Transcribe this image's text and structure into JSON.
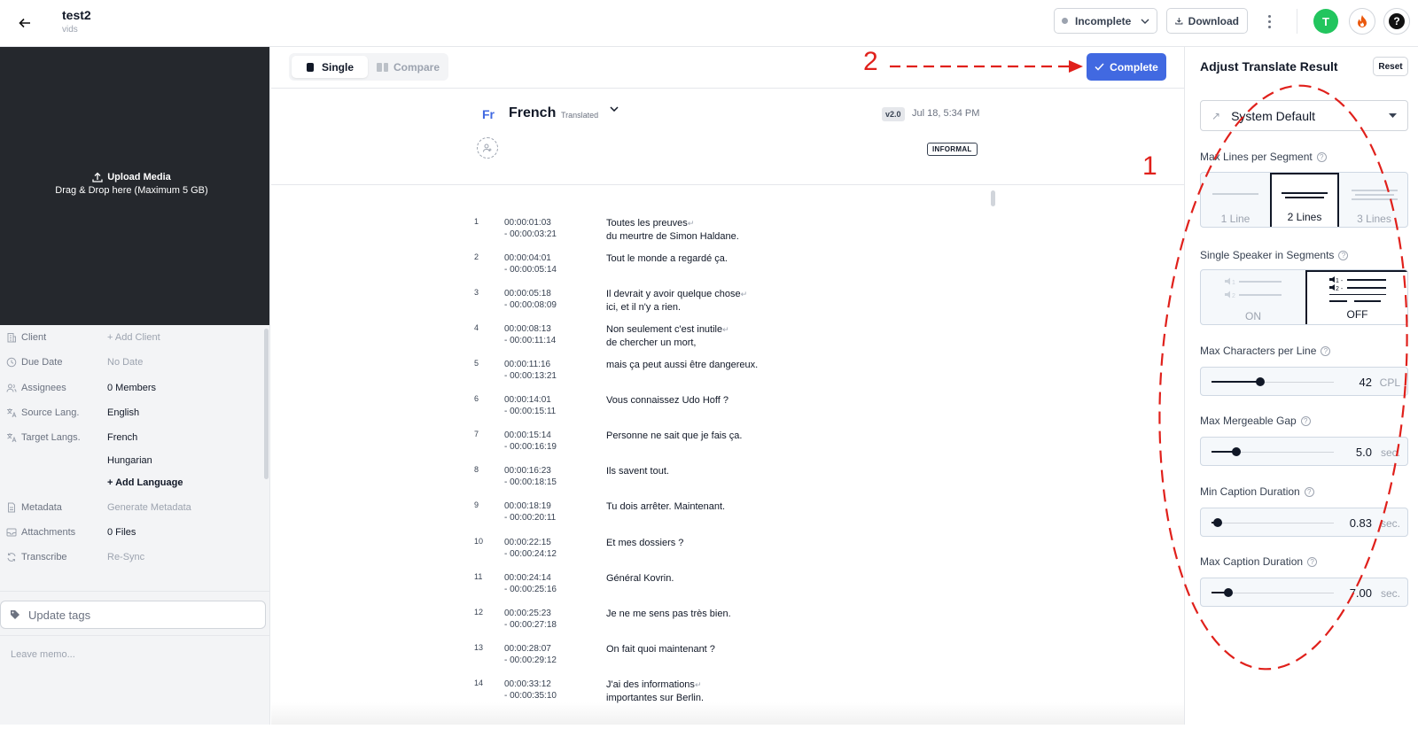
{
  "topbar": {
    "title": "test2",
    "subtitle": "vids",
    "status": "Incomplete",
    "download_label": "Download",
    "avatar_initial": "T"
  },
  "media": {
    "upload_title": "Upload Media",
    "upload_hint": "Drag & Drop here (Maximum 5 GB)"
  },
  "meta": {
    "client_label": "Client",
    "client_value": "+ Add Client",
    "due_label": "Due Date",
    "due_value": "No Date",
    "assignees_label": "Assignees",
    "assignees_value": "0 Members",
    "source_label": "Source Lang.",
    "source_value": "English",
    "target_label": "Target Langs.",
    "target_values": [
      "French",
      "Hungarian"
    ],
    "add_language": "+ Add Language",
    "metadata_label": "Metadata",
    "metadata_value": "Generate Metadata",
    "attachments_label": "Attachments",
    "attachments_value": "0 Files",
    "transcribe_label": "Transcribe",
    "transcribe_value": "Re-Sync"
  },
  "tags_placeholder": "Update tags",
  "memo_placeholder": "Leave memo...",
  "toolbar": {
    "single_label": "Single",
    "compare_label": "Compare",
    "complete_label": "Complete"
  },
  "language": {
    "abbr": "Fr",
    "name": "French",
    "state": "Translated",
    "version": "v2.0",
    "date": "Jul 18, 5:34 PM",
    "tone": "INFORMAL"
  },
  "segments": [
    {
      "num": "1",
      "start": "00:00:01:03",
      "end": "- 00:00:03:21",
      "line1": "Toutes les preuves",
      "line2": "du meurtre de Simon Haldane."
    },
    {
      "num": "2",
      "start": "00:00:04:01",
      "end": "- 00:00:05:14",
      "line1": "Tout le monde a regardé ça.",
      "line2": ""
    },
    {
      "num": "3",
      "start": "00:00:05:18",
      "end": "- 00:00:08:09",
      "line1": "Il devrait y avoir quelque chose",
      "line2": "ici, et il n'y a rien."
    },
    {
      "num": "4",
      "start": "00:00:08:13",
      "end": "- 00:00:11:14",
      "line1": "Non seulement c'est inutile",
      "line2": "de chercher un mort,"
    },
    {
      "num": "5",
      "start": "00:00:11:16",
      "end": "- 00:00:13:21",
      "line1": "mais ça peut aussi être dangereux.",
      "line2": ""
    },
    {
      "num": "6",
      "start": "00:00:14:01",
      "end": "- 00:00:15:11",
      "line1": "Vous connaissez Udo Hoff ?",
      "line2": ""
    },
    {
      "num": "7",
      "start": "00:00:15:14",
      "end": "- 00:00:16:19",
      "line1": "Personne ne sait que je fais ça.",
      "line2": ""
    },
    {
      "num": "8",
      "start": "00:00:16:23",
      "end": "- 00:00:18:15",
      "line1": "Ils savent tout.",
      "line2": ""
    },
    {
      "num": "9",
      "start": "00:00:18:19",
      "end": "- 00:00:20:11",
      "line1": "Tu dois arrêter. Maintenant.",
      "line2": ""
    },
    {
      "num": "10",
      "start": "00:00:22:15",
      "end": "- 00:00:24:12",
      "line1": "Et mes dossiers ?",
      "line2": ""
    },
    {
      "num": "11",
      "start": "00:00:24:14",
      "end": "- 00:00:25:16",
      "line1": "Général Kovrin.",
      "line2": ""
    },
    {
      "num": "12",
      "start": "00:00:25:23",
      "end": "- 00:00:27:18",
      "line1": "Je ne me sens pas très bien.",
      "line2": ""
    },
    {
      "num": "13",
      "start": "00:00:28:07",
      "end": "- 00:00:29:12",
      "line1": "On fait quoi maintenant ?",
      "line2": ""
    },
    {
      "num": "14",
      "start": "00:00:33:12",
      "end": "- 00:00:35:10",
      "line1": "J'ai des informations",
      "line2": "importantes sur Berlin."
    }
  ],
  "panel": {
    "title": "Adjust Translate Result",
    "reset_label": "Reset",
    "preset": "System Default",
    "max_lines_label": "Max Lines per Segment",
    "max_lines_options": [
      "1 Line",
      "2 Lines",
      "3 Lines"
    ],
    "max_lines_selected": "2 Lines",
    "speaker_label": "Single Speaker in Segments",
    "speaker_options": [
      "ON",
      "OFF"
    ],
    "speaker_selected": "OFF",
    "max_chars_label": "Max Characters per Line",
    "max_chars_value": "42",
    "max_chars_unit": "CPL",
    "max_chars_fraction": 0.4,
    "gap_label": "Max Mergeable Gap",
    "gap_value": "5.0",
    "gap_unit": "sec.",
    "gap_fraction": 0.2,
    "min_dur_label": "Min Caption Duration",
    "min_dur_value": "0.83",
    "min_dur_unit": "sec.",
    "min_dur_fraction": 0.05,
    "max_dur_label": "Max Caption Duration",
    "max_dur_value": "7.00",
    "max_dur_unit": "sec.",
    "max_dur_fraction": 0.14
  },
  "annotations": {
    "label_1": "1",
    "label_2": "2",
    "color": "#e0201b"
  }
}
